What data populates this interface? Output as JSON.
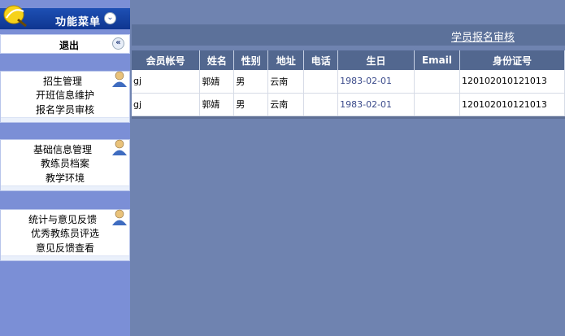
{
  "sidebar": {
    "menu_title": "功能菜单",
    "exit_label": "退出",
    "groups": [
      {
        "title": "招生管理",
        "items": [
          "开班信息维护",
          "报名学员审核"
        ]
      },
      {
        "title": "基础信息管理",
        "items": [
          "教练员档案",
          "教学环境"
        ]
      },
      {
        "title": "统计与意见反馈",
        "items": [
          "优秀教练员评选",
          "意见反馈查看"
        ]
      }
    ]
  },
  "main": {
    "banner_title": "学员报名审核",
    "columns": [
      "会员帐号",
      "姓名",
      "性别",
      "地址",
      "电话",
      "生日",
      "Email",
      "身份证号"
    ],
    "rows": [
      [
        "gj",
        "郭婧",
        "男",
        "云南",
        "",
        "1983-02-01",
        "",
        "120102010121013"
      ],
      [
        "gj",
        "郭婧",
        "男",
        "云南",
        "",
        "1983-02-01",
        "",
        "120102010121013"
      ]
    ]
  },
  "colors": {
    "sidebar_bg": "#7b8fd6",
    "header_blue": "#0e3590",
    "table_header": "#52678f",
    "page_bg": "#6f83b0"
  }
}
